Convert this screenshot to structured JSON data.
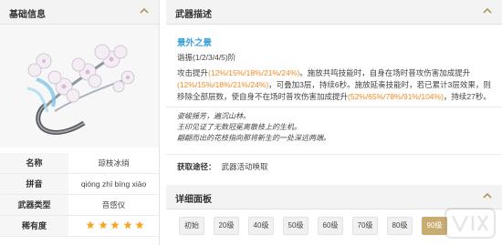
{
  "left": {
    "title": "基础信息",
    "rows": [
      {
        "key": "名称",
        "value": "琼枝冰绡"
      },
      {
        "key": "拼音",
        "value": "qióng zhī bīng xiāo"
      },
      {
        "key": "武器类型",
        "value": "音感仪"
      },
      {
        "key": "稀有度",
        "stars": 5
      }
    ]
  },
  "right": {
    "title": "武器描述",
    "weapon_name": "景外之景",
    "refine": "谐振(1/2/3/4/5)阶",
    "effect": {
      "p1": "攻击提升",
      "p1_val": "(12%/15%/18%/21%/24%)",
      "p2": "。施放共鸣技能时，自身在场时普攻伤害加成提升",
      "p2_val": "(12%/15%/18%/21%/24%)",
      "p3": "，可叠加3层，持续6秒。施放延奏技能时，若已累计3层效果，则移除全部层数，使自身不在场时普攻伤害加成提升",
      "p3_val": "(52%/65%/78%/91%/104%)",
      "p4": "，持续27秒。"
    },
    "story": [
      "姿峻摇芳，遍沉山林。",
      "王印见证了无数冠冕离散枝上的生机。",
      "翩翩而出的花枝指向那将新生的一处深远两端。"
    ],
    "source_label": "获取途径：",
    "source_value": "武器活动唤取"
  },
  "detail": {
    "title": "详细面板",
    "levels": [
      "初始",
      "20级",
      "40级",
      "50级",
      "60级",
      "70级",
      "80级",
      "90级"
    ],
    "active_level": "90级"
  },
  "colors": {
    "accent_orange": "#f08a24",
    "accent_blue": "#3aa0d8",
    "tab_active": "#c9ac72"
  }
}
